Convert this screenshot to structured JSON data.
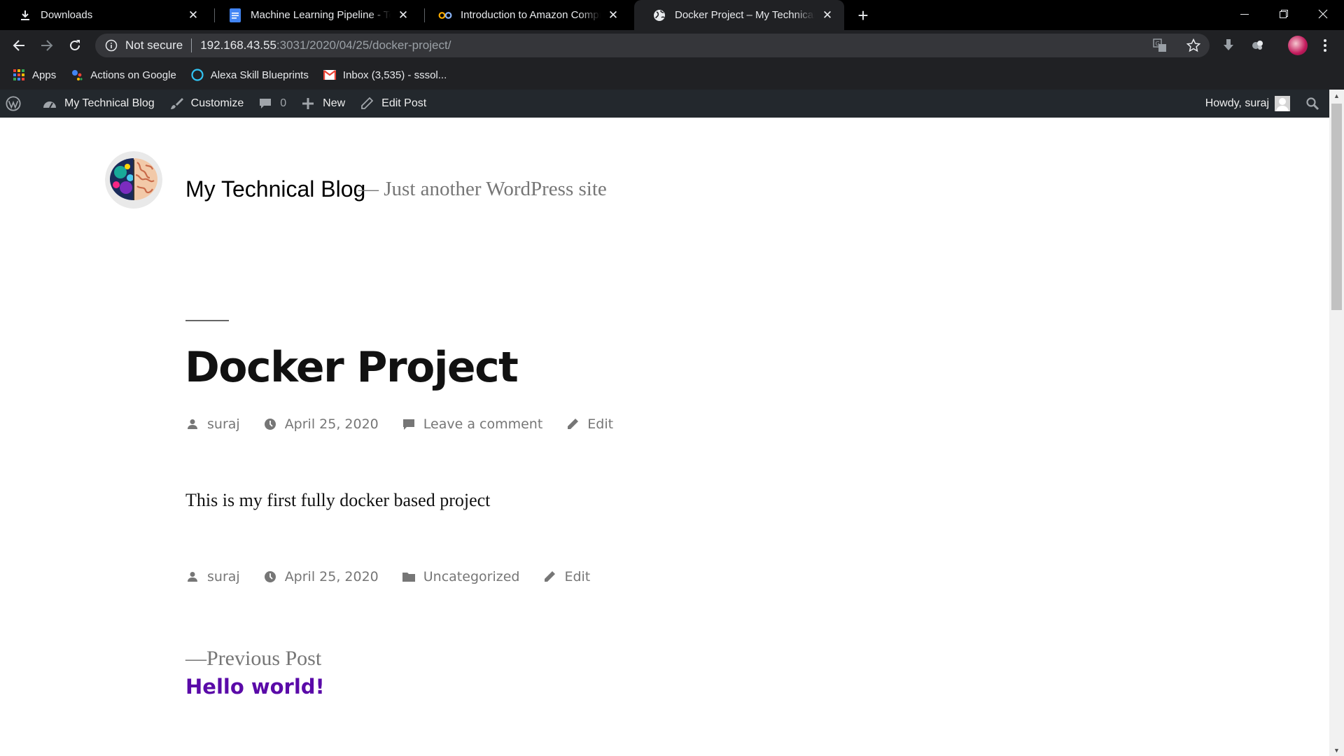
{
  "browser": {
    "tabs": [
      {
        "title": "Downloads",
        "icon": "download-icon",
        "active": false
      },
      {
        "title": "Machine Learning Pipeline - Testi",
        "icon": "google-docs-icon",
        "active": false
      },
      {
        "title": "Introduction to Amazon Compre",
        "icon": "colab-icon",
        "active": false
      },
      {
        "title": "Docker Project – My Technical Bl",
        "icon": "globe-icon",
        "active": true
      }
    ],
    "address": {
      "security_label": "Not secure",
      "host": "192.168.43.55",
      "path": ":3031/2020/04/25/docker-project/"
    },
    "bookmarks": [
      {
        "label": "Apps",
        "icon": "apps-grid-icon"
      },
      {
        "label": "Actions on Google",
        "icon": "actions-on-google-icon"
      },
      {
        "label": "Alexa Skill Blueprints",
        "icon": "alexa-icon"
      },
      {
        "label": "Inbox (3,535) - sssol...",
        "icon": "gmail-icon"
      }
    ]
  },
  "admin_bar": {
    "site_name": "My Technical Blog",
    "customize": "Customize",
    "comments_count": "0",
    "new": "New",
    "edit_post": "Edit Post",
    "howdy": "Howdy, suraj"
  },
  "site": {
    "title": "My Technical Blog",
    "description": "— Just another WordPress site"
  },
  "post": {
    "title": "Docker Project",
    "author": "suraj",
    "date": "April 25, 2020",
    "comment_link": "Leave a comment",
    "edit_link": "Edit",
    "body": "This is my first fully docker based project",
    "category": "Uncategorized",
    "previous_label": "—Previous Post",
    "previous_title": "Hello world!"
  },
  "colors": {
    "admin_bar_bg": "#23282d",
    "link_purple": "#5a0aa8",
    "meta_gray": "#767676"
  }
}
